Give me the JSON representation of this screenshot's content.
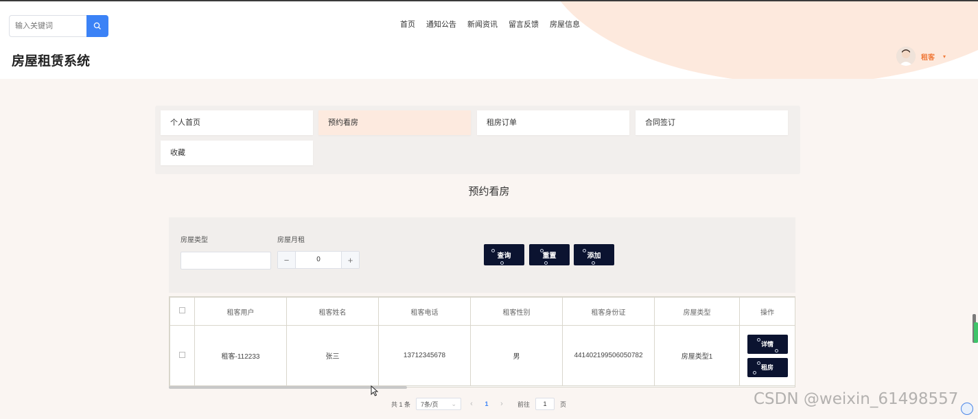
{
  "header": {
    "search_placeholder": "输入关键词",
    "site_title": "房屋租赁系统",
    "nav": [
      "首页",
      "通知公告",
      "新闻资讯",
      "留言反馈",
      "房屋信息"
    ],
    "user_name": "租客"
  },
  "menu": {
    "items": [
      "个人首页",
      "预约看房",
      "租房订单",
      "合同签订",
      "收藏"
    ],
    "active": "预约看房"
  },
  "page_title": "预约看房",
  "filter": {
    "type_label": "房屋类型",
    "type_value": "",
    "rent_label": "房屋月租",
    "rent_value": "0",
    "query_btn": "查询",
    "reset_btn": "重置",
    "add_btn": "添加"
  },
  "table": {
    "headers": [
      "租客用户",
      "租客姓名",
      "租客电话",
      "租客性别",
      "租客身份证",
      "房屋类型",
      "操作"
    ],
    "rows": [
      {
        "user": "租客-112233",
        "name": "张三",
        "phone": "13712345678",
        "gender": "男",
        "id_card": "441402199506050782",
        "house_type": "房屋类型1",
        "actions": [
          "详情",
          "租房"
        ]
      }
    ]
  },
  "pagination": {
    "total": "共 1 条",
    "page_size": "7条/页",
    "current": "1",
    "goto_label": "前往",
    "goto_value": "1",
    "page_suffix": "页"
  },
  "watermark": "CSDN @weixin_61498557",
  "colors": {
    "accent": "#3b82f6",
    "dark_button": "#0b1330",
    "user_orange": "#f07a3a",
    "active_menu": "#fdeadf"
  }
}
